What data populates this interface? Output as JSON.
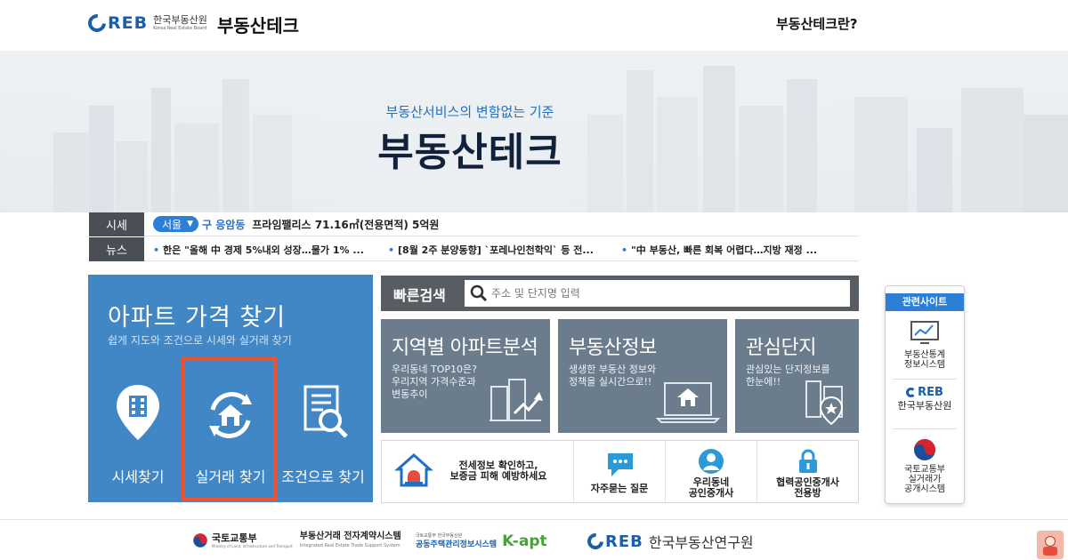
{
  "header": {
    "logo_text": "REB",
    "logo_korean": "한국부동산원",
    "logo_english": "Korea Real Estate Board",
    "site_name": "부동산테크",
    "about_link": "부동산테크란?"
  },
  "hero": {
    "subtitle": "부동산서비스의 변함없는 기준",
    "title": "부동산테크"
  },
  "ticker": {
    "price_tag": "시세",
    "region": "서울",
    "district": "구 응암동",
    "price_text": "프라임팰리스 71.16㎡(전용면적) 5억원",
    "news_tag": "뉴스",
    "news": [
      "한은 \"올해 中 경제 5%내외 성장…물가 1% ...",
      "[8월 2주 분양동향] `포레나인천학익` 등 전...",
      "\"中 부동산, 빠른 회복 어렵다…지방 재정 ..."
    ]
  },
  "apt_panel": {
    "title": "아파트 가격 찾기",
    "subtitle": "쉽게 지도와 조건으로 시세와 실거래 찾기",
    "items": [
      {
        "label": "시세찾기",
        "icon": "map-pin-building-icon"
      },
      {
        "label": "실거래 찾기",
        "icon": "house-refresh-icon"
      },
      {
        "label": "조건으로 찾기",
        "icon": "document-search-icon"
      }
    ]
  },
  "quick_search": {
    "label": "빠른검색",
    "placeholder": "주소 및 단지명 입력"
  },
  "tiles": [
    {
      "title": "지역별 아파트분석",
      "desc": "우리동네 TOP10은?\n우리지역 가격수준과\n변동추이"
    },
    {
      "title": "부동산정보",
      "desc": "생생한 부동산 정보와\n정책을 실시간으로!!"
    },
    {
      "title": "관심단지",
      "desc": "관심있는 단지정보를\n한눈에!!"
    }
  ],
  "quick_links": [
    {
      "label": "전세정보 확인하고,\n보증금 피해 예방하세요"
    },
    {
      "label": "자주묻는 질문"
    },
    {
      "label": "우리동네\n공인중개사"
    },
    {
      "label": "협력공인중개사\n전용방"
    }
  ],
  "related": {
    "title": "관련사이트",
    "items": [
      {
        "label": "부동산통계\n정보시스템"
      },
      {
        "label": "한국부동산원",
        "logo": "REB"
      },
      {
        "label": "국토교통부\n실거래가\n공개시스템"
      }
    ]
  },
  "footer": {
    "molit_name": "국토교통부",
    "molit_english": "Ministry of Land, Infrastructure and Transport",
    "contract_system": "부동산거래 전자계약시스템",
    "contract_system_en": "Integrated Real Estate Trade Support System",
    "kapt_small": "국토교통부 한국부동산원",
    "kapt_system": "공동주택관리정보시스템",
    "kapt": "K-apt",
    "reb_logo": "REB",
    "reb_institute": "한국부동산연구원"
  },
  "colors": {
    "brand_blue": "#1a5fa8",
    "panel_blue": "#4187c6",
    "tile_gray": "#6b7d8d",
    "highlight": "#f0522d"
  }
}
